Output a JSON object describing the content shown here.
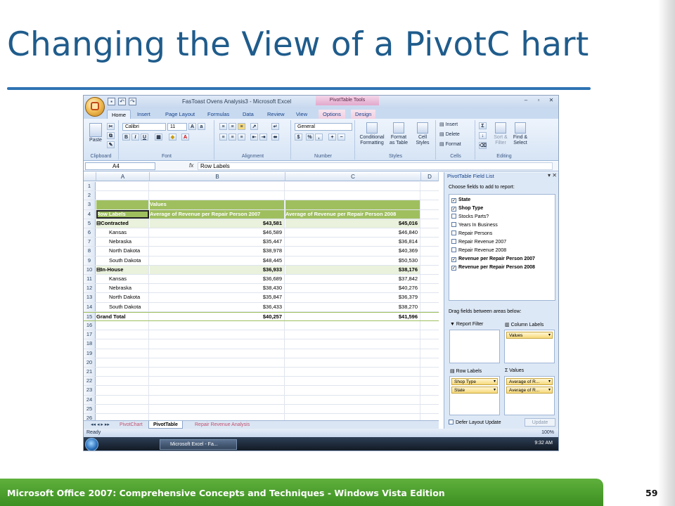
{
  "slide": {
    "title": "Changing the View of a PivotC hart",
    "footer": "Microsoft Office 2007: Comprehensive Concepts and Techniques - Windows Vista Edition",
    "page": "59"
  },
  "excel": {
    "window_title": "FasToast Ovens Analysis3 - Microsoft Excel",
    "context_tab_group": "PivotTable Tools",
    "tabs": [
      "Home",
      "Insert",
      "Page Layout",
      "Formulas",
      "Data",
      "Review",
      "View",
      "Options",
      "Design"
    ],
    "ribbon": {
      "paste": "Paste",
      "font_name": "Calibri",
      "font_size": "11",
      "number_format": "General",
      "conditional_formatting": "Conditional Formatting",
      "format_as_table": "Format as Table",
      "cell_styles": "Cell Styles",
      "insert": "Insert",
      "delete": "Delete",
      "format": "Format",
      "sort_filter": "Sort & Filter",
      "find_select": "Find & Select",
      "groups": [
        "Clipboard",
        "Font",
        "Alignment",
        "Number",
        "Styles",
        "Cells",
        "Editing"
      ]
    },
    "name_box": "A4",
    "formula_label": "fx",
    "formula": "Row Labels",
    "columns": [
      "A",
      "B",
      "C",
      "D"
    ],
    "rows": [
      {
        "n": "1",
        "a": "",
        "b": "",
        "c": ""
      },
      {
        "n": "2",
        "a": "",
        "b": "",
        "c": ""
      },
      {
        "n": "3",
        "a": "",
        "b": "Values",
        "c": ""
      },
      {
        "n": "4",
        "a": "Row Labels",
        "b": "Average of Revenue per Repair Person 2007",
        "c": "Average of Revenue per Repair Person 2008"
      },
      {
        "n": "5",
        "a": "⊟Contracted",
        "b": "$43,581",
        "c": "$45,016"
      },
      {
        "n": "6",
        "a": "Kansas",
        "b": "$46,589",
        "c": "$46,840"
      },
      {
        "n": "7",
        "a": "Nebraska",
        "b": "$35,447",
        "c": "$36,814"
      },
      {
        "n": "8",
        "a": "North Dakota",
        "b": "$38,978",
        "c": "$40,369"
      },
      {
        "n": "9",
        "a": "South Dakota",
        "b": "$48,445",
        "c": "$50,530"
      },
      {
        "n": "10",
        "a": "⊟In-House",
        "b": "$36,933",
        "c": "$38,176"
      },
      {
        "n": "11",
        "a": "Kansas",
        "b": "$36,689",
        "c": "$37,842"
      },
      {
        "n": "12",
        "a": "Nebraska",
        "b": "$38,430",
        "c": "$40,276"
      },
      {
        "n": "13",
        "a": "North Dakota",
        "b": "$35,847",
        "c": "$36,379"
      },
      {
        "n": "14",
        "a": "South Dakota",
        "b": "$36,433",
        "c": "$38,270"
      },
      {
        "n": "15",
        "a": "Grand Total",
        "b": "$40,257",
        "c": "$41,596"
      },
      {
        "n": "16",
        "a": "",
        "b": "",
        "c": ""
      },
      {
        "n": "17",
        "a": "",
        "b": "",
        "c": ""
      },
      {
        "n": "18",
        "a": "",
        "b": "",
        "c": ""
      },
      {
        "n": "19",
        "a": "",
        "b": "",
        "c": ""
      },
      {
        "n": "20",
        "a": "",
        "b": "",
        "c": ""
      },
      {
        "n": "21",
        "a": "",
        "b": "",
        "c": ""
      },
      {
        "n": "22",
        "a": "",
        "b": "",
        "c": ""
      },
      {
        "n": "23",
        "a": "",
        "b": "",
        "c": ""
      },
      {
        "n": "24",
        "a": "",
        "b": "",
        "c": ""
      },
      {
        "n": "25",
        "a": "",
        "b": "",
        "c": ""
      },
      {
        "n": "26",
        "a": "",
        "b": "",
        "c": ""
      }
    ],
    "sheet_tabs": [
      "PivotChart",
      "PivotTable",
      "Repair Revenue Analysis"
    ],
    "active_sheet": "PivotTable",
    "status": "Ready",
    "zoom": "100%",
    "taskbar_item": "Microsoft Excel - Fa...",
    "clock": "9:32 AM"
  },
  "field_list": {
    "title": "PivotTable Field List",
    "choose_label": "Choose fields to add to report:",
    "fields": [
      {
        "label": "State",
        "checked": true
      },
      {
        "label": "Shop Type",
        "checked": true
      },
      {
        "label": "Stocks Parts?",
        "checked": false
      },
      {
        "label": "Years In Business",
        "checked": false
      },
      {
        "label": "Repair Persons",
        "checked": false
      },
      {
        "label": "Repair Revenue 2007",
        "checked": false
      },
      {
        "label": "Repair Revenue 2008",
        "checked": false
      },
      {
        "label": "Revenue per Repair Person 2007",
        "checked": true
      },
      {
        "label": "Revenue per Repair Person 2008",
        "checked": true
      }
    ],
    "drag_label": "Drag fields between areas below:",
    "report_filter": "Report Filter",
    "column_labels": "Column Labels",
    "row_labels": "Row Labels",
    "values": "Values",
    "column_items": [
      "Values"
    ],
    "row_items": [
      "Shop Type",
      "State"
    ],
    "value_items": [
      "Average of R...",
      "Average of R..."
    ],
    "defer": "Defer Layout Update",
    "update": "Update"
  }
}
